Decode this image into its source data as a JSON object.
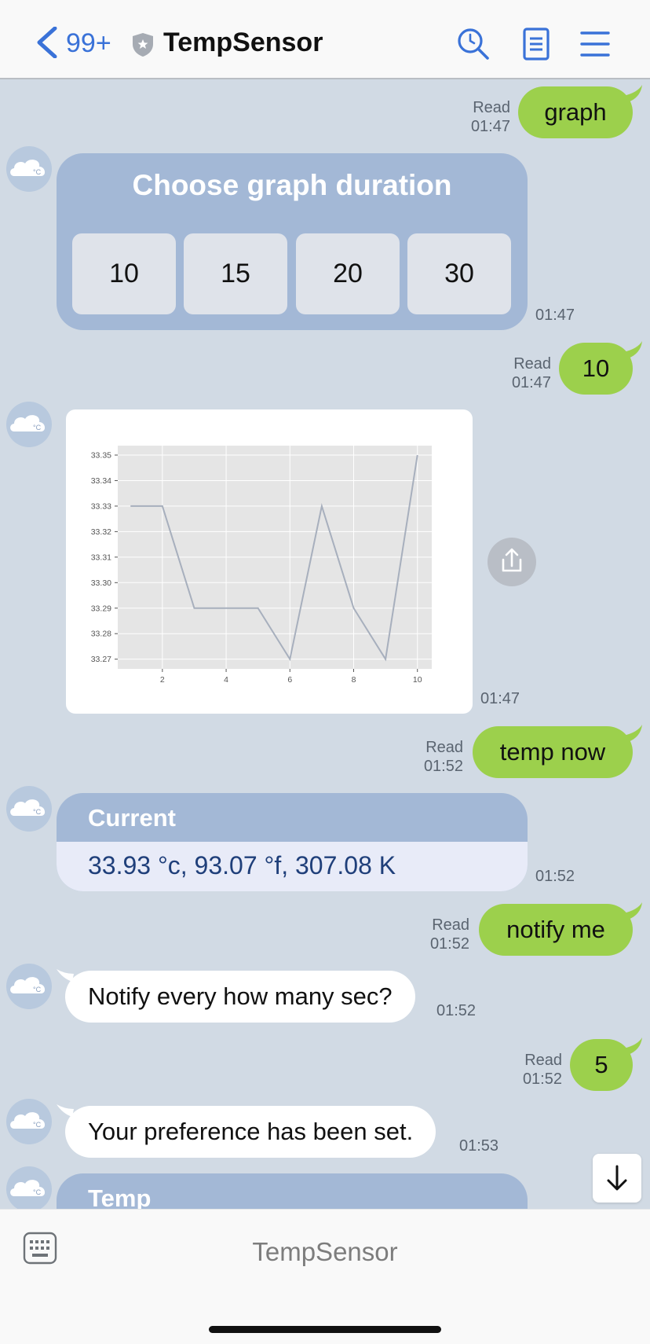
{
  "header": {
    "unread_count": "99+",
    "title": "TempSensor"
  },
  "messages": {
    "m1": {
      "text": "graph",
      "status": "Read",
      "time": "01:47"
    },
    "m2": {
      "title": "Choose graph duration",
      "options": [
        "10",
        "15",
        "20",
        "30"
      ],
      "time": "01:47"
    },
    "m3": {
      "text": "10",
      "status": "Read",
      "time": "01:47"
    },
    "m4": {
      "time": "01:47"
    },
    "m5": {
      "text": "temp now",
      "status": "Read",
      "time": "01:52"
    },
    "m6": {
      "title": "Current",
      "body": "33.93 °c, 93.07 °f, 307.08 K",
      "time": "01:52"
    },
    "m7": {
      "text": "notify me",
      "status": "Read",
      "time": "01:52"
    },
    "m8": {
      "text": "Notify every how many sec?",
      "time": "01:52"
    },
    "m9": {
      "text": "5",
      "status": "Read",
      "time": "01:52"
    },
    "m10": {
      "text": "Your preference has been set.",
      "time": "01:53"
    },
    "m11": {
      "title": "Temp"
    }
  },
  "chart_data": {
    "type": "line",
    "x": [
      1,
      2,
      3,
      4,
      5,
      6,
      7,
      8,
      9,
      10
    ],
    "series": [
      {
        "values": [
          33.33,
          33.33,
          33.29,
          33.29,
          33.29,
          33.27,
          33.33,
          33.29,
          33.27,
          33.35
        ]
      }
    ],
    "xticks": [
      "2",
      "4",
      "6",
      "8",
      "10"
    ],
    "yticks": [
      "33.35",
      "33.34",
      "33.33",
      "33.32",
      "33.31",
      "33.30",
      "33.29",
      "33.28",
      "33.27"
    ],
    "xlim": [
      0.6,
      10.45
    ],
    "ylim": [
      33.2662,
      33.3537
    ],
    "grid": true,
    "line_color": "#a7afbd",
    "plot_background": "#e5e5e5"
  },
  "footer": {
    "label": "TempSensor"
  },
  "icons": {
    "back": "chevron-left-icon",
    "shield": "shield-icon",
    "search": "search-icon",
    "notes": "notes-icon",
    "menu": "menu-icon",
    "keyboard": "keyboard-icon",
    "share": "share-icon",
    "scroll_down": "arrow-down-icon"
  },
  "colors": {
    "accent": "#3a72d8",
    "outgoing_bubble": "#9cd04c",
    "card": "#a3b8d6",
    "chat_background": "#d1dae4"
  }
}
